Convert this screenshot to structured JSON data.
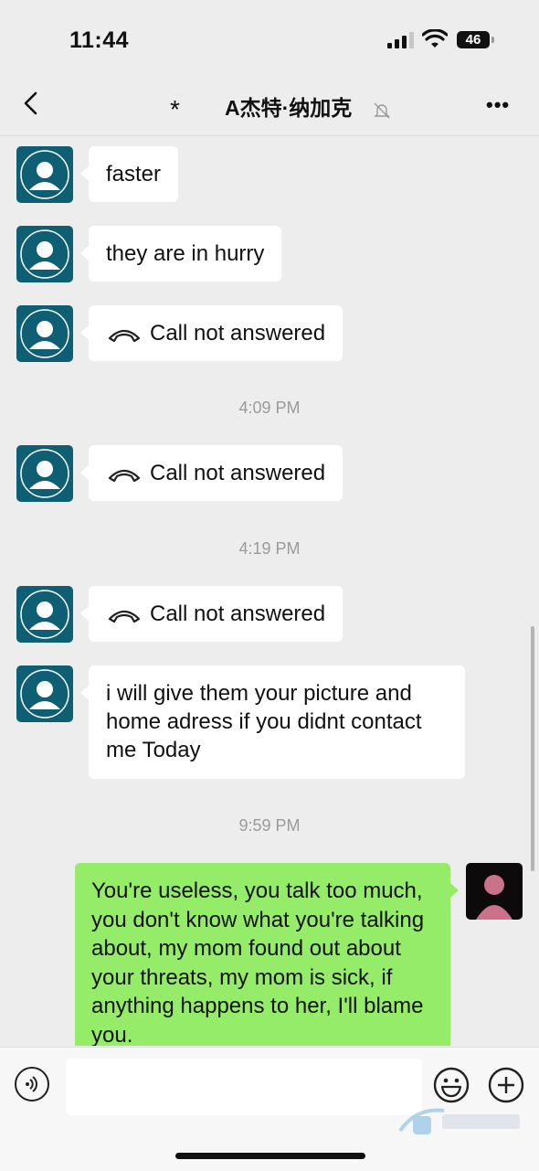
{
  "status_bar": {
    "time": "11:44",
    "battery": "46"
  },
  "nav": {
    "star": "*",
    "title": "A杰特·纳加克"
  },
  "messages": [
    {
      "type": "text",
      "text": "faster"
    },
    {
      "type": "text",
      "text": "they are in hurry"
    },
    {
      "type": "call",
      "text": "Call not answered"
    },
    {
      "type": "time",
      "text": "4:09 PM"
    },
    {
      "type": "call",
      "text": "Call not answered"
    },
    {
      "type": "time",
      "text": "4:19 PM"
    },
    {
      "type": "call",
      "text": "Call not answered"
    },
    {
      "type": "text",
      "text": "i will give them your picture and home adress if you didnt contact me Today"
    },
    {
      "type": "time",
      "text": "9:59 PM"
    },
    {
      "type": "me",
      "text": "You're useless, you talk too much, you don't know what you're talking about, my mom found out about your threats, my mom is sick, if anything happens to her, I'll blame you."
    }
  ],
  "colors": {
    "self_bubble": "#95ec69",
    "other_bubble": "#ffffff",
    "background": "#ededed"
  },
  "icons": [
    "back-icon",
    "mute-bell-icon",
    "more-icon",
    "phone-hangup-icon",
    "voice-icon",
    "emoji-icon",
    "plus-icon"
  ]
}
